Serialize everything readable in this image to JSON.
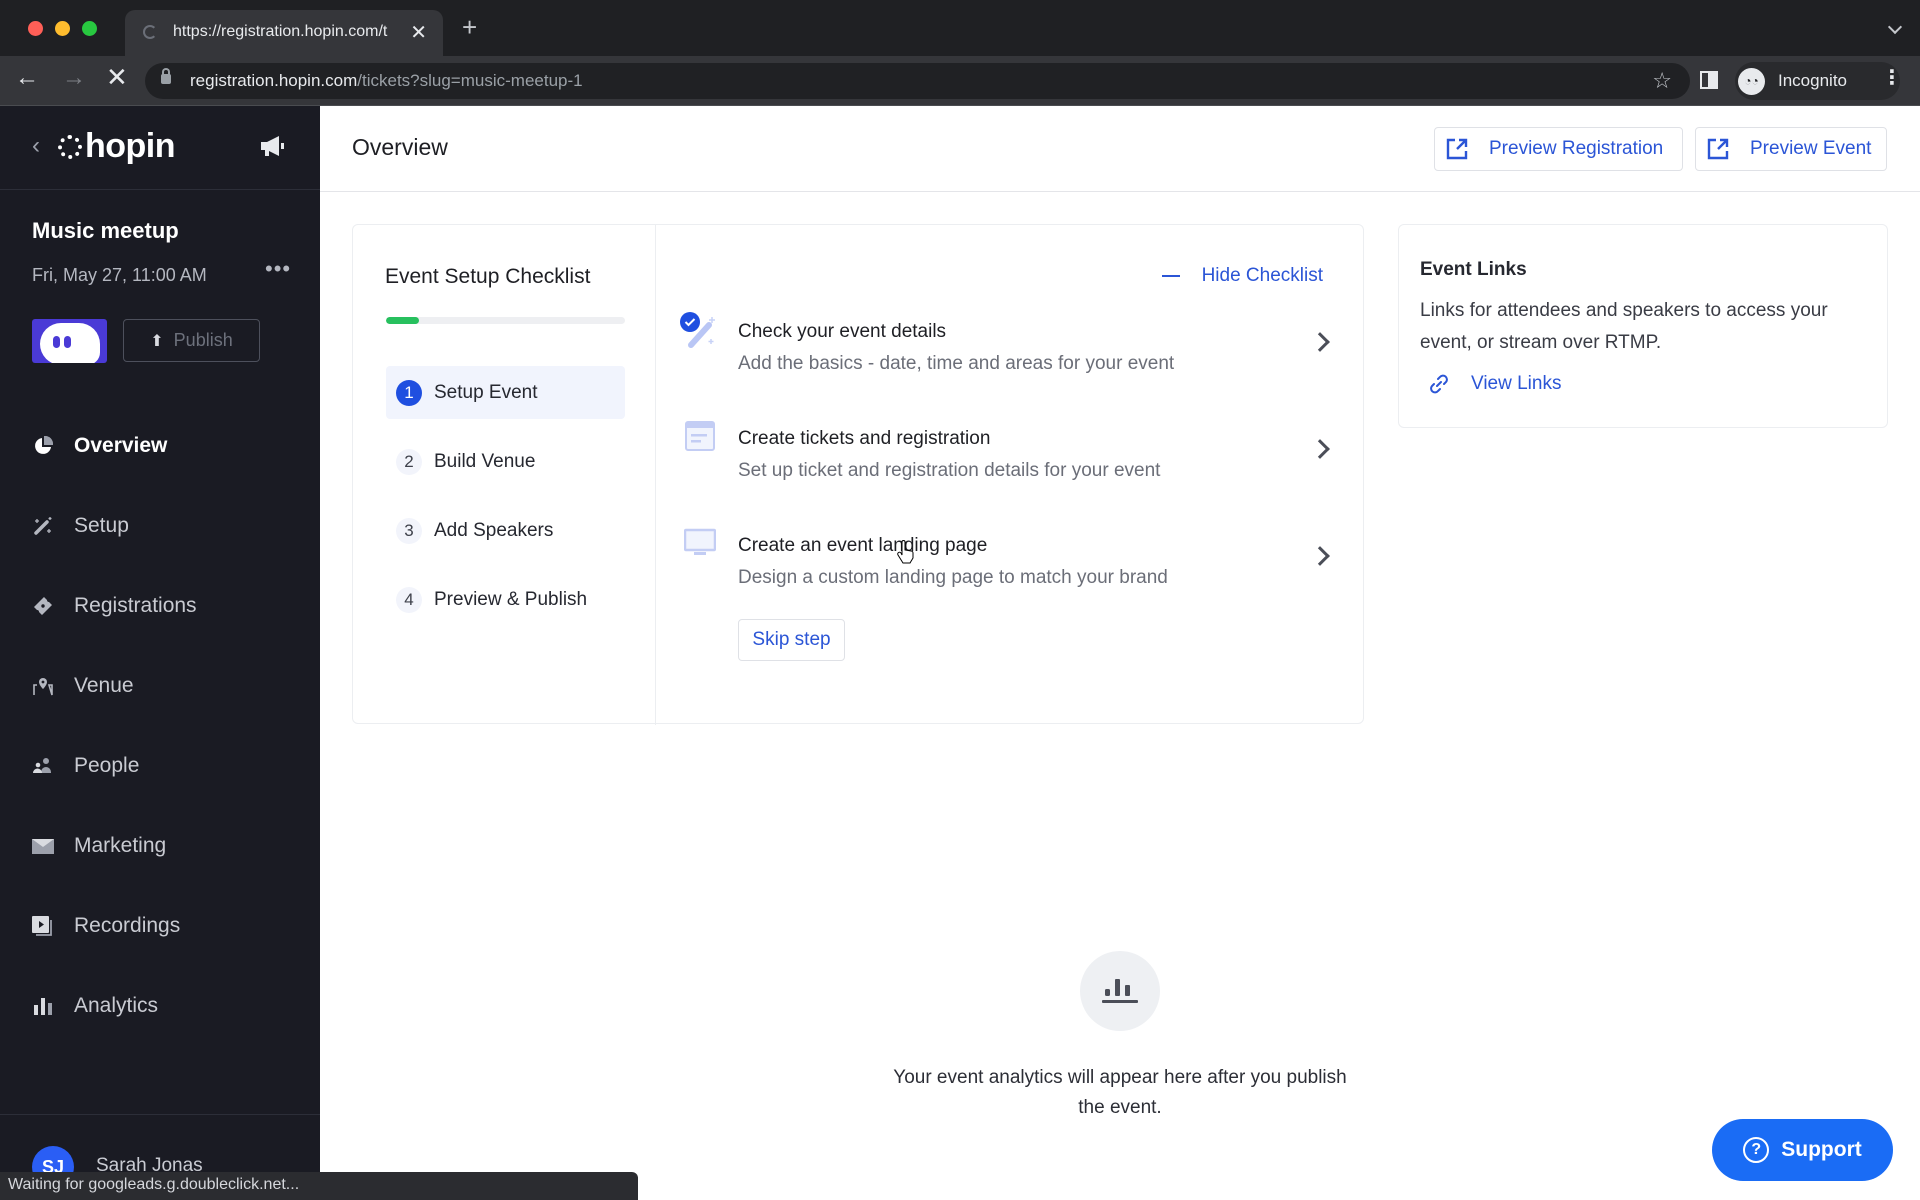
{
  "browser": {
    "tab_title": "https://registration.hopin.com/t",
    "url_host": "registration.hopin.com",
    "url_path": "/tickets?slug=music-meetup-1",
    "profile_label": "Incognito",
    "status_text": "Waiting for googleads.g.doubleclick.net..."
  },
  "sidebar": {
    "brand": "hopin",
    "event_name": "Music meetup",
    "event_date": "Fri, May 27, 11:00 AM",
    "publish_label": "Publish",
    "items": [
      {
        "label": "Overview",
        "icon": "pie-chart-icon",
        "active": true
      },
      {
        "label": "Setup",
        "icon": "magic-wand-icon",
        "active": false
      },
      {
        "label": "Registrations",
        "icon": "ticket-icon",
        "active": false
      },
      {
        "label": "Venue",
        "icon": "map-pin-icon",
        "active": false
      },
      {
        "label": "People",
        "icon": "people-icon",
        "active": false
      },
      {
        "label": "Marketing",
        "icon": "envelope-icon",
        "active": false
      },
      {
        "label": "Recordings",
        "icon": "video-play-icon",
        "active": false
      },
      {
        "label": "Analytics",
        "icon": "bar-chart-icon",
        "active": false
      }
    ],
    "user": {
      "initials": "SJ",
      "name": "Sarah Jonas"
    }
  },
  "header": {
    "title": "Overview",
    "preview_registration_label": "Preview Registration",
    "preview_event_label": "Preview Event"
  },
  "checklist": {
    "title": "Event Setup Checklist",
    "progress_percent": 14,
    "hide_label": "Hide Checklist",
    "steps": [
      {
        "number": "1",
        "label": "Setup Event",
        "active": true
      },
      {
        "number": "2",
        "label": "Build Venue",
        "active": false
      },
      {
        "number": "3",
        "label": "Add Speakers",
        "active": false
      },
      {
        "number": "4",
        "label": "Preview & Publish",
        "active": false
      }
    ],
    "tasks": [
      {
        "title": "Check your event details",
        "description": "Add the basics - date, time and areas for your event",
        "completed": true,
        "icon": "magic-wand-check-icon"
      },
      {
        "title": "Create tickets and registration",
        "description": "Set up ticket and registration details for your event",
        "completed": false,
        "icon": "form-window-icon"
      },
      {
        "title": "Create an event landing page",
        "description": "Design a custom landing page to match your brand",
        "completed": false,
        "icon": "monitor-icon"
      }
    ],
    "skip_label": "Skip step"
  },
  "event_links": {
    "title": "Event Links",
    "description": "Links for attendees and speakers to access your event, or stream over RTMP.",
    "view_label": "View Links"
  },
  "analytics_empty": {
    "message": "Your event analytics will appear here after you publish the event."
  },
  "support": {
    "label": "Support"
  },
  "colors": {
    "accent": "#2b55d6",
    "primary_blue": "#1f4fe0",
    "support_blue": "#1a6cf5",
    "progress_green": "#27c05e",
    "sidebar_bg": "#1a1b23"
  }
}
